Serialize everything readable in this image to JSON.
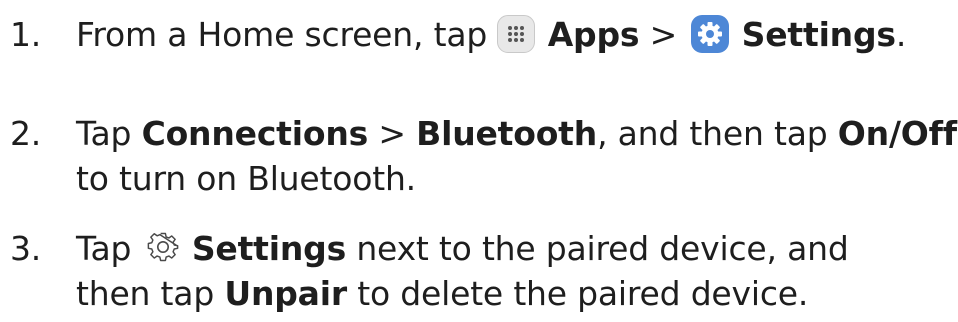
{
  "steps": [
    {
      "number": "1.",
      "text_before": "From a Home screen, tap",
      "apps_label": "Apps",
      "separator": ">",
      "settings_label": "Settings",
      "period": ".",
      "icons": [
        "apps-icon",
        "settings-icon"
      ]
    },
    {
      "number": "2.",
      "text_before": "Tap",
      "connections_label": "Connections",
      "separator": ">",
      "bluetooth_label": "Bluetooth",
      "text_middle": ", and then tap",
      "onoff_label": "On/Off",
      "line2": "to turn on Bluetooth."
    },
    {
      "number": "3.",
      "text_before": "Tap",
      "settings_label": "Settings",
      "text_after": "next to the paired device, and",
      "line2_before": "then tap",
      "unpair_label": "Unpair",
      "line2_after": "to delete the paired device.",
      "icons": [
        "gear-icon"
      ]
    }
  ],
  "colors": {
    "text": "#1e1e1e",
    "apps_icon_bg": "#e8e8e8",
    "settings_icon_bg": "#4d87d6",
    "gear_outline": "#4a4a4a"
  }
}
